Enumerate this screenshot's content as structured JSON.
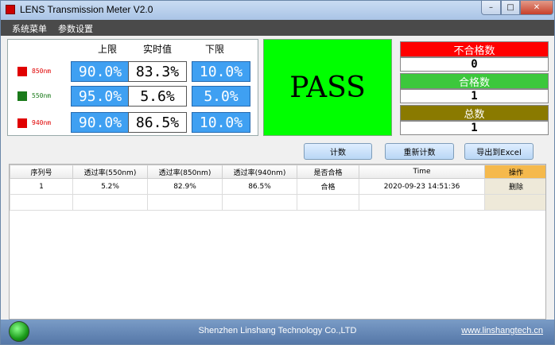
{
  "window": {
    "title": "LENS Transmission Meter V2.0",
    "controls": {
      "minimize": "–",
      "maximize": "□",
      "close": "✕"
    }
  },
  "menu": {
    "system": "系统菜单",
    "params": "参数设置"
  },
  "limits": {
    "headers": {
      "upper": "上限",
      "realtime": "实时值",
      "lower": "下限"
    },
    "rows": [
      {
        "wavelength": "850nm",
        "color": "#e00000",
        "upper": "90.0%",
        "realtime": "83.3%",
        "lower": "10.0%"
      },
      {
        "wavelength": "550nm",
        "color": "#1a7a1a",
        "upper": "95.0%",
        "realtime": "5.6%",
        "lower": "5.0%"
      },
      {
        "wavelength": "940nm",
        "color": "#e00000",
        "upper": "90.0%",
        "realtime": "86.5%",
        "lower": "10.0%"
      }
    ]
  },
  "status": {
    "result": "PASS",
    "pass_bg": "#00ff00"
  },
  "counts": {
    "fail": {
      "label": "不合格数",
      "value": "0",
      "color": "#ff0000"
    },
    "pass": {
      "label": "合格数",
      "value": "1",
      "color": "#3cc83c"
    },
    "total": {
      "label": "总数",
      "value": "1",
      "color": "#8a7a00"
    }
  },
  "buttons": {
    "count": "计数",
    "recount": "重新计数",
    "export": "导出到Excel"
  },
  "table": {
    "columns": [
      "序列号",
      "透过率(550nm)",
      "透过率(850nm)",
      "透过率(940nm)",
      "是否合格",
      "Time",
      "操作"
    ],
    "rows": [
      {
        "serial": "1",
        "t550": "5.2%",
        "t850": "82.9%",
        "t940": "86.5%",
        "qualified": "合格",
        "time": "2020-09-23 14:51:36",
        "action": "删除"
      }
    ]
  },
  "footer": {
    "company": "Shenzhen Linshang Technology Co.,LTD",
    "website": "www.linshangtech.cn"
  }
}
